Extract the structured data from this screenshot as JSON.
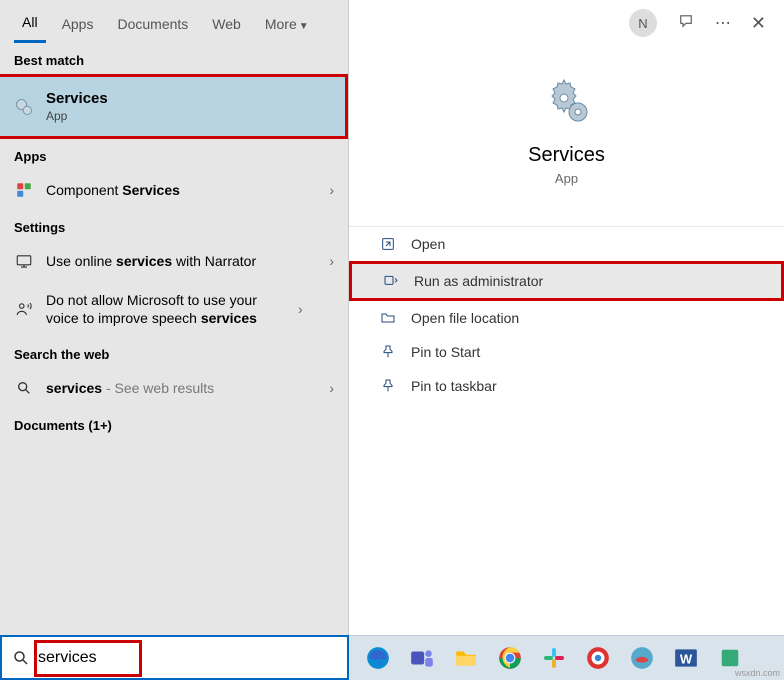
{
  "tabs": {
    "all": "All",
    "apps": "Apps",
    "documents": "Documents",
    "web": "Web",
    "more": "More"
  },
  "sections": {
    "best_match": "Best match",
    "apps": "Apps",
    "settings": "Settings",
    "search_web": "Search the web",
    "documents": "Documents (1+)"
  },
  "best_match_item": {
    "title": "Services",
    "sub": "App"
  },
  "apps_items": {
    "component_services": {
      "prefix": "Component ",
      "bold": "Services"
    }
  },
  "settings_items": {
    "narrator": {
      "p1": "Use online ",
      "b1": "services",
      "p2": " with Narrator"
    },
    "speech": {
      "p1": "Do not allow Microsoft to use your voice to improve speech ",
      "b1": "services"
    }
  },
  "web_items": {
    "services": {
      "bold": "services",
      "suffix": " - See web results"
    }
  },
  "avatar_letter": "N",
  "preview": {
    "title": "Services",
    "sub": "App"
  },
  "actions": {
    "open": "Open",
    "run_admin": "Run as administrator",
    "open_loc": "Open file location",
    "pin_start": "Pin to Start",
    "pin_taskbar": "Pin to taskbar"
  },
  "search": {
    "value": "services"
  },
  "watermark": "wsxdn.com"
}
